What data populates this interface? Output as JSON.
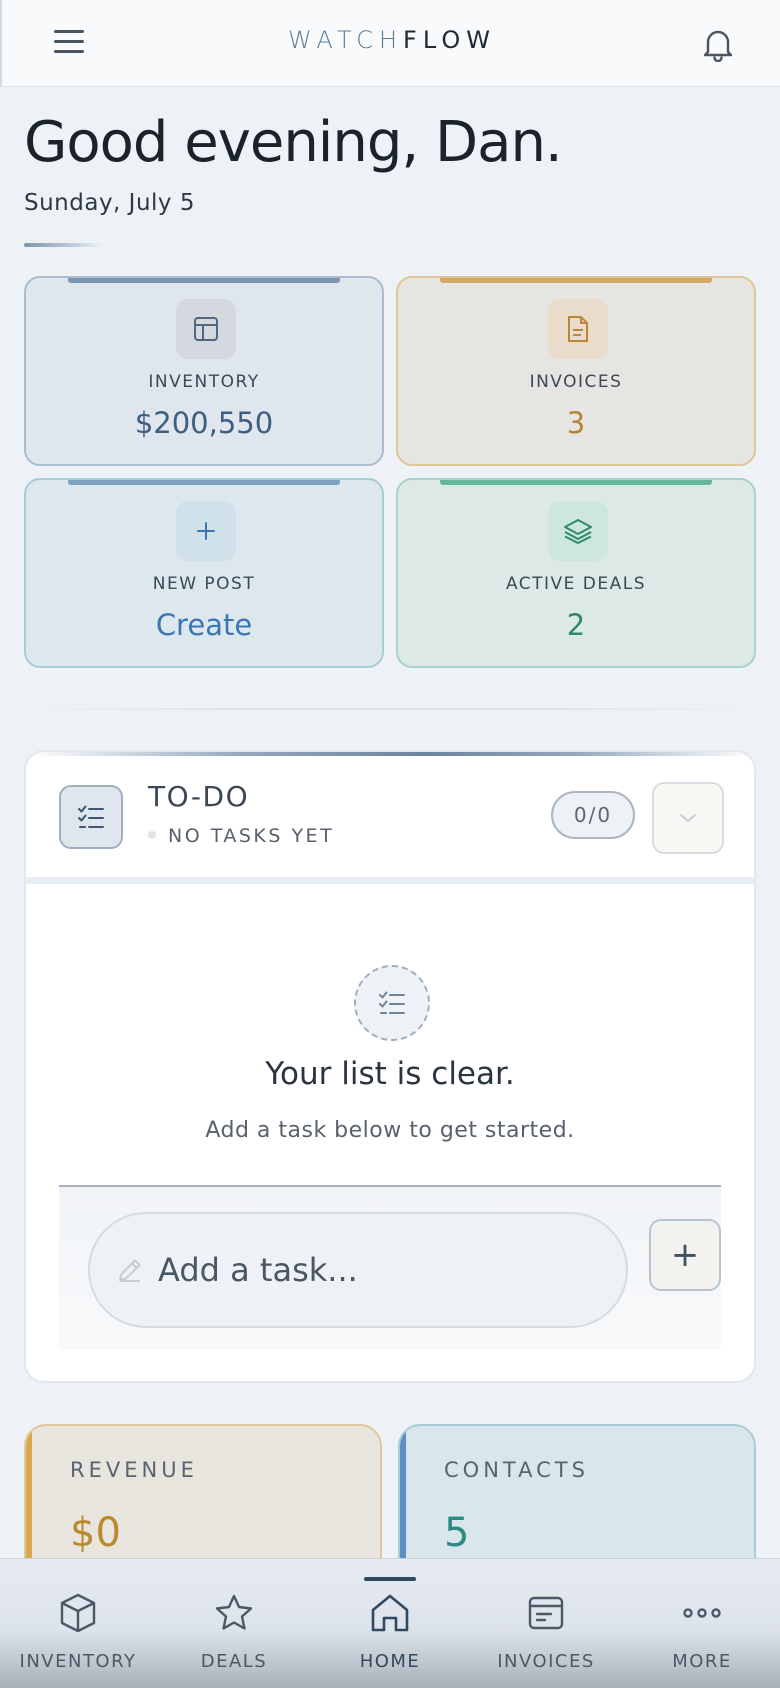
{
  "header": {
    "brand_part1": "WATCH",
    "brand_part2": "FLOW",
    "menu_icon": "hamburger-menu-icon",
    "notifications_icon": "bell-icon"
  },
  "greeting": {
    "title": "Good evening, Dan.",
    "date": "Sunday, July 5"
  },
  "stats": [
    {
      "label": "INVENTORY",
      "value": "$200,550",
      "icon": "layout-grid-icon",
      "color": "#3e5f80"
    },
    {
      "label": "INVOICES",
      "value": "3",
      "icon": "document-icon",
      "color": "#b48434"
    },
    {
      "label": "NEW POST",
      "value": "Create",
      "icon": "plus-icon",
      "color": "#3a76b3"
    },
    {
      "label": "ACTIVE DEALS",
      "value": "2",
      "icon": "layers-icon",
      "color": "#2f8a67"
    }
  ],
  "todo": {
    "title": "TO-DO",
    "subtitle": "NO TASKS YET",
    "count": "0/0",
    "empty_title": "Your list is clear.",
    "empty_subtitle": "Add a task below to get started.",
    "input_placeholder": "Add a task...",
    "add_button": "+"
  },
  "summary": [
    {
      "label": "REVENUE",
      "value": "$0",
      "color": "#b98a2e"
    },
    {
      "label": "CONTACTS",
      "value": "5",
      "color": "#2b8c82"
    }
  ],
  "nav": {
    "items": [
      {
        "label": "INVENTORY",
        "icon": "cube-icon",
        "active": false
      },
      {
        "label": "DEALS",
        "icon": "star-icon",
        "active": false
      },
      {
        "label": "HOME",
        "icon": "home-icon",
        "active": true
      },
      {
        "label": "INVOICES",
        "icon": "invoice-icon",
        "active": false
      },
      {
        "label": "MORE",
        "icon": "more-dots-icon",
        "active": false
      }
    ]
  }
}
